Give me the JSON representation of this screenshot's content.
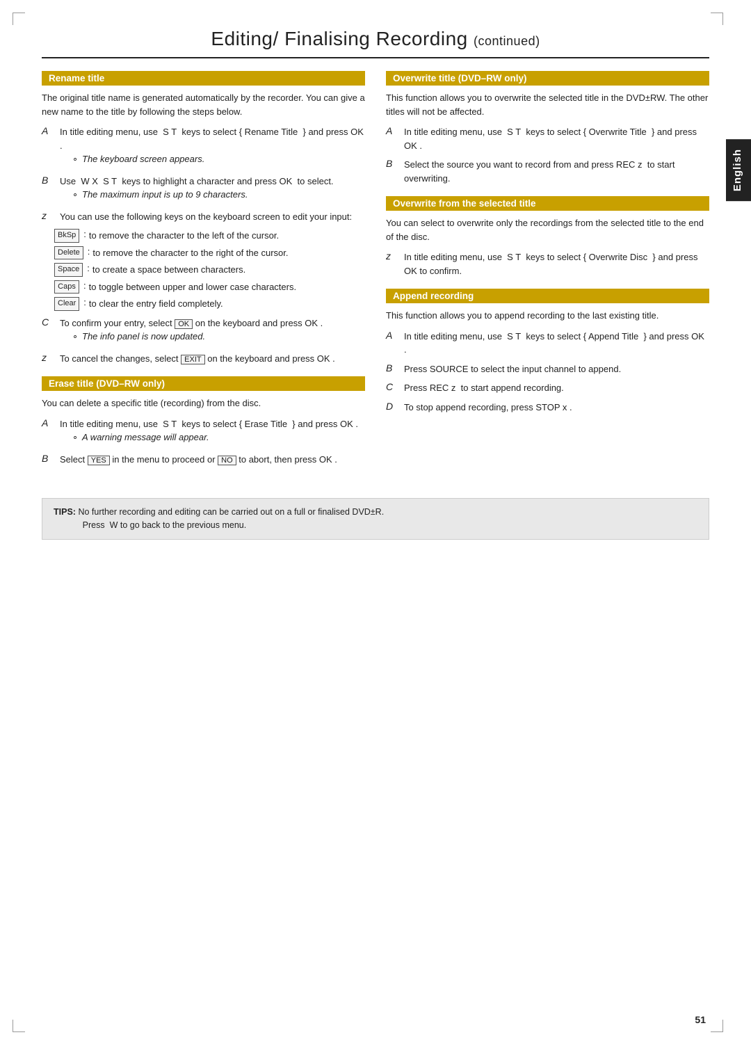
{
  "page": {
    "title": "Editing/ Finalising Recording",
    "continued": "(continued)",
    "page_number": "51",
    "sidebar_label": "English"
  },
  "left_column": {
    "rename_title": {
      "header": "Rename title",
      "intro": "The original title name is generated automatically by the recorder. You can give a new name to the title by following the steps below.",
      "steps": [
        {
          "label": "A",
          "text": "In title editing menu, use  S T  keys to select { Rename Title  } and press OK .",
          "sub": "The keyboard screen appears."
        },
        {
          "label": "B",
          "text": "Use  W X  S T  keys to highlight a character and press OK  to select.",
          "sub": "The maximum input is up to 9 characters."
        },
        {
          "label": "z",
          "text": "You can use the following keys on the keyboard screen to edit your input:"
        }
      ],
      "keys": [
        {
          "key": "BkSp",
          "desc": ": to remove the character to the left of the cursor."
        },
        {
          "key": "Delete",
          "desc": ": to remove the character to the right of the cursor."
        },
        {
          "key": "Space",
          "desc": ": to create a space between characters."
        },
        {
          "key": "Caps",
          "desc": ": to toggle between upper and lower case characters."
        },
        {
          "key": "Clear",
          "desc": ": to clear the entry field completely."
        }
      ],
      "step_c": {
        "label": "C",
        "text_before": "To confirm your entry, select ",
        "btn": "OK",
        "text_after": " on the keyboard and press OK .",
        "sub": "The info panel is now updated."
      },
      "step_z2": {
        "label": "z",
        "text_before": "To cancel the changes, select ",
        "btn": "EXIT",
        "text_after": " on the keyboard and press OK ."
      }
    },
    "erase_title": {
      "header": "Erase title (DVD–RW only)",
      "intro": "You can delete a specific title (recording) from the disc.",
      "steps": [
        {
          "label": "A",
          "text": "In title editing menu, use  S T  keys to select { Erase Title  } and press OK .",
          "sub": "A warning message will appear."
        }
      ],
      "step_b": {
        "label": "B",
        "text_before": "Select ",
        "btn1": "YES",
        "text_mid": " in the menu to proceed or ",
        "btn2": "NO",
        "text_after": " to abort, then press OK ."
      }
    }
  },
  "right_column": {
    "overwrite_title": {
      "header": "Overwrite title (DVD–RW only)",
      "intro": "This function allows you to overwrite the selected title in the DVD±RW. The other titles will not be affected.",
      "steps": [
        {
          "label": "A",
          "text": "In title editing menu, use  S T  keys to select { Overwrite Title  } and press OK ."
        },
        {
          "label": "B",
          "text": "Select the source you want to record from and press REC z  to start overwriting."
        }
      ]
    },
    "overwrite_selected": {
      "header": "Overwrite from the selected title",
      "intro": "You can select to overwrite only the recordings from the selected title to the end of the disc.",
      "steps": [
        {
          "label": "z",
          "text": "In title editing menu, use  S T  keys to select { Overwrite Disc  } and press OK to confirm."
        }
      ]
    },
    "append_recording": {
      "header": "Append recording",
      "intro": "This function allows you to append recording to the last existing title.",
      "steps": [
        {
          "label": "A",
          "text": "In title editing menu, use  S T  keys to select { Append Title  } and press OK ."
        },
        {
          "label": "B",
          "text": "Press SOURCE to select the input channel to append."
        },
        {
          "label": "C",
          "text": "Press REC z  to start append recording."
        },
        {
          "label": "D",
          "text": "To stop append recording, press STOP x ."
        }
      ]
    }
  },
  "tips": {
    "label": "TIPS:",
    "text": "No further recording and editing can be carried out on a full or finalised DVD±R.",
    "text2": "Press  W to go back to the previous menu."
  }
}
